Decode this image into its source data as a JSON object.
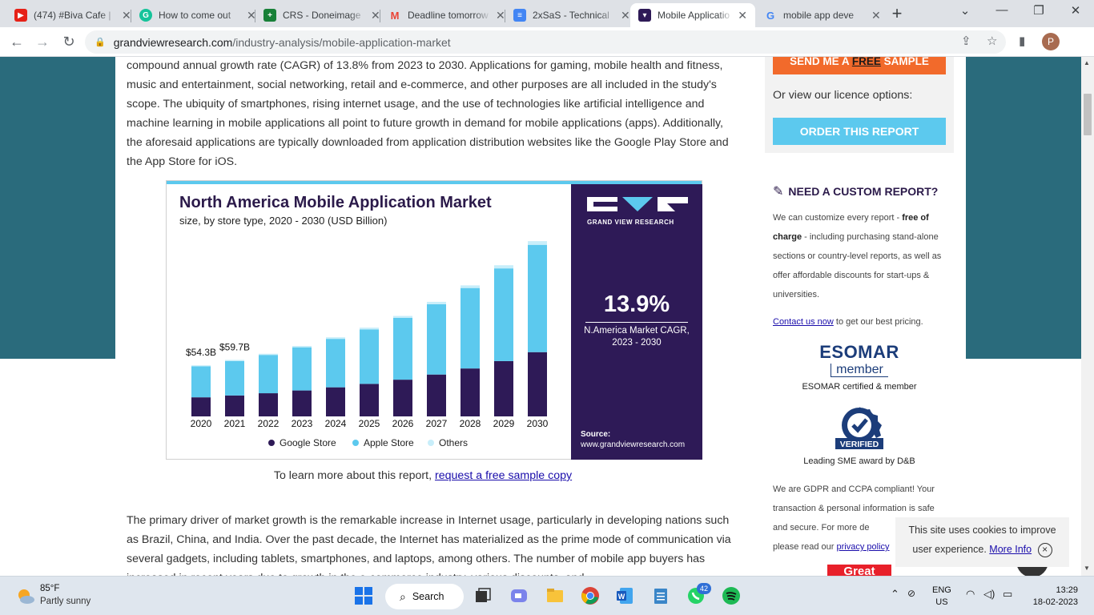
{
  "browser": {
    "tabs": [
      {
        "title": "(474) #Biva Cafe |",
        "icon_color": "#e62117",
        "icon_glyph": "▶"
      },
      {
        "title": "How to come out",
        "icon_color": "#15c39a",
        "icon_glyph": "G"
      },
      {
        "title": "CRS - Doneimage",
        "icon_color": "#188038",
        "icon_glyph": "+"
      },
      {
        "title": "Deadline tomorrow",
        "icon_color": "#ffffff",
        "icon_glyph": "M"
      },
      {
        "title": "2xSaS - Technical",
        "icon_color": "#4285f4",
        "icon_glyph": "≡"
      },
      {
        "title": "Mobile Applicatio",
        "icon_color": "#2e1a57",
        "icon_glyph": "▾"
      },
      {
        "title": "mobile app deve",
        "icon_color": "#ffffff",
        "icon_glyph": "G"
      }
    ],
    "url_domain": "grandviewresearch.com",
    "url_path": "/industry-analysis/mobile-application-market",
    "profile_initial": "P"
  },
  "article": {
    "para1": "compound annual growth rate (CAGR) of 13.8% from 2023 to 2030. Applications for gaming, mobile health and fitness, music and entertainment, social networking, retail and e-commerce, and other purposes are all included in the study's scope. The ubiquity of smartphones, rising internet usage, and the use of technologies like artificial intelligence and machine learning in mobile applications all point to future growth in demand for mobile applications (apps). Additionally, the aforesaid applications are typically downloaded from application distribution websites like the Google Play Store and the App Store for iOS.",
    "learn_prefix": "To learn more about this report, ",
    "learn_link": "request a free sample copy",
    "para2": "The primary driver of market growth is the remarkable increase in Internet usage, particularly in developing nations such as Brazil, China, and India. Over the past decade, the Internet has materialized as the prime mode of communication via several gadgets, including tablets, smartphones, and laptops, among others. The number of mobile app buyers has increased in recent years due to growth in the e-commerce industry, various discounts, and"
  },
  "infographic": {
    "brand": "GRAND VIEW RESEARCH",
    "cagr_value": "13.9%",
    "cagr_label": "N.America Market CAGR,",
    "cagr_period": "2023 - 2030",
    "source_label": "Source:",
    "source_url": "www.grandviewresearch.com",
    "colors": {
      "google": "#2e1a57",
      "apple": "#5cc9ee",
      "others": "#c8eefa",
      "panel": "#2e1a57"
    }
  },
  "chart_data": {
    "type": "bar",
    "stacked": true,
    "title": "North America Mobile Application Market",
    "subtitle": "size, by store type, 2020 - 2030 (USD Billion)",
    "categories": [
      "2020",
      "2021",
      "2022",
      "2023",
      "2024",
      "2025",
      "2026",
      "2027",
      "2028",
      "2029",
      "2030"
    ],
    "series": [
      {
        "name": "Google Store",
        "values": [
          14.5,
          15.9,
          17.6,
          19.7,
          22.1,
          24.7,
          27.9,
          31.8,
          36.4,
          42.0,
          48.8
        ]
      },
      {
        "name": "Apple Store",
        "values": [
          23.6,
          26.2,
          29.1,
          32.8,
          36.8,
          41.4,
          46.9,
          53.4,
          61.1,
          70.4,
          81.5
        ]
      },
      {
        "name": "Others",
        "values": [
          0.7,
          0.8,
          0.9,
          1.0,
          1.2,
          1.3,
          1.5,
          1.8,
          2.0,
          2.4,
          2.8
        ]
      }
    ],
    "annotations": [
      {
        "category": "2020",
        "label": "$54.3B"
      },
      {
        "category": "2021",
        "label": "$59.7B"
      }
    ],
    "legend_position": "bottom",
    "grid": false
  },
  "sidebar": {
    "sample_prefix": "SEND ME A ",
    "sample_free": "FREE",
    "sample_suffix": " SAMPLE",
    "licence_text": "Or view our licence options:",
    "order_label": "ORDER THIS REPORT",
    "custom_title": "NEED A CUSTOM REPORT?",
    "custom_p1_a": "We can customize every report - ",
    "custom_p1_b": "free of charge",
    "custom_p1_c": " - including purchasing stand-alone sections or country-level reports, as well as offer affordable discounts for start-ups & universities.",
    "contact_link": "Contact us now",
    "contact_rest": " to get our best pricing.",
    "esomar_big": "ESOMAR",
    "esomar_member": "member",
    "esomar_caption": "ESOMAR certified & member",
    "dnb_text": "VERIFIED",
    "dnb_caption": "Leading SME award by D&B",
    "gdpr_text": "We are GDPR and CCPA compliant! Your transaction & personal information is safe and secure. For more de",
    "privacy_prefix": "please read our ",
    "privacy_link": "privacy policy",
    "great": "Great"
  },
  "cookie": {
    "text": "This site uses cookies to improve user experience.",
    "more": "More Info",
    "close": "×"
  },
  "taskbar": {
    "temp": "85°F",
    "weather": "Partly sunny",
    "search": "Search",
    "badge": "42",
    "lang1": "ENG",
    "lang2": "US",
    "time": "13:29",
    "date": "18-02-2023"
  }
}
